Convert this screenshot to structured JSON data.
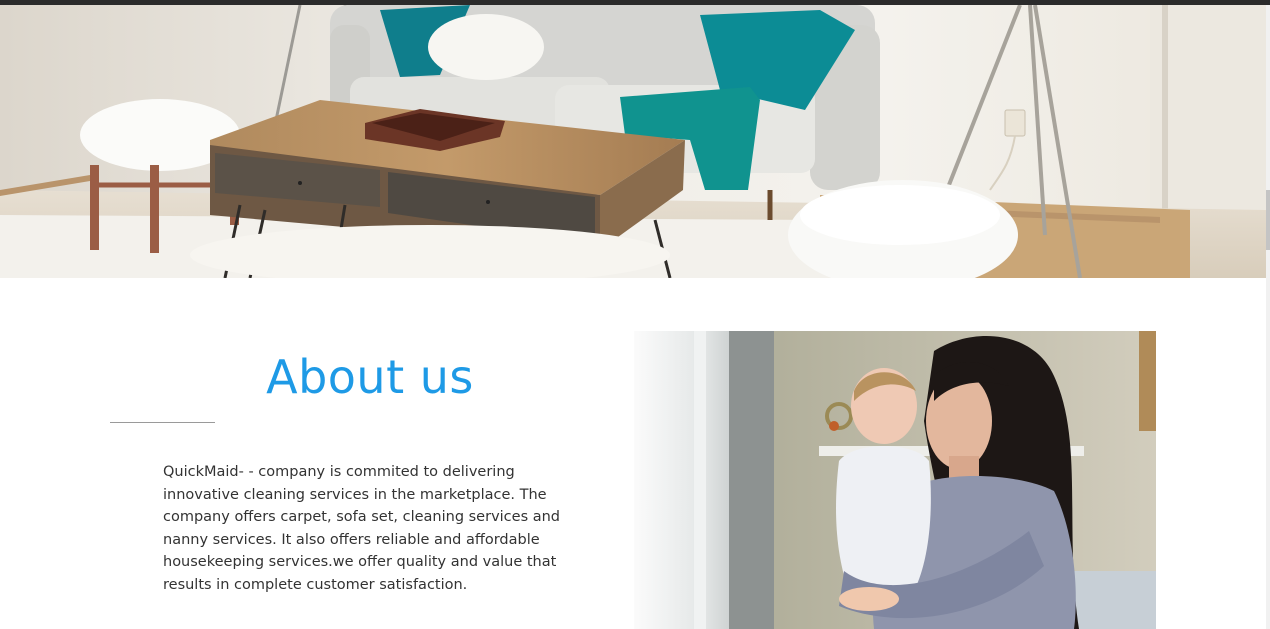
{
  "hero": {
    "image_subject": "living-room-photo"
  },
  "about": {
    "title": "About us",
    "description": "QuickMaid- - company is commited to delivering innovative cleaning services in the marketplace. The company offers carpet, sofa set, cleaning services and nanny services. It also offers reliable and affordable housekeeping services.we offer quality and value that results in complete customer satisfaction.",
    "photo_subject": "mother-and-baby-photo"
  },
  "colors": {
    "title_blue": "#1e9ae6",
    "body_text": "#333333",
    "top_bar": "#2b2b2b"
  }
}
